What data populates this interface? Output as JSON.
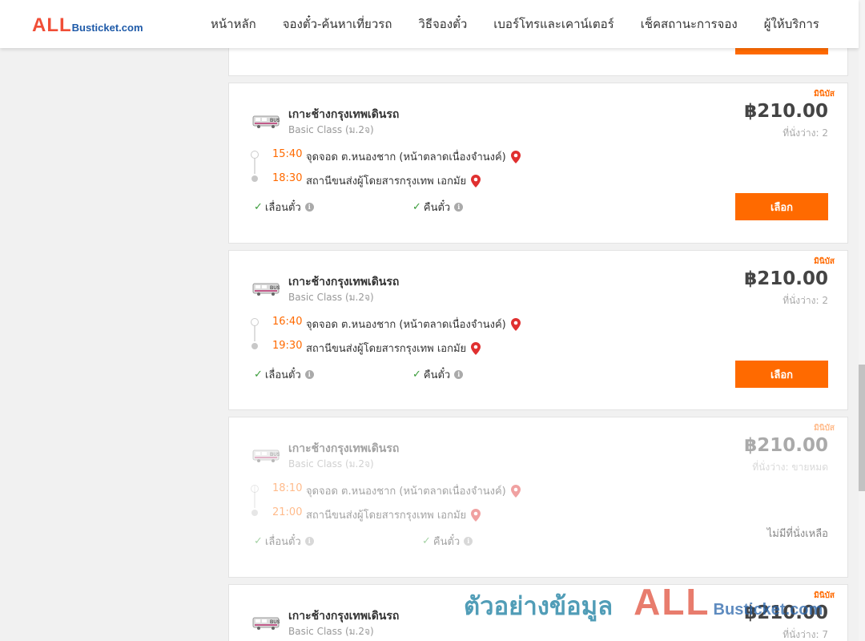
{
  "header": {
    "logo_all": "ALL",
    "logo_rest": "Busticket.com",
    "nav": [
      "หน้าหลัก",
      "จองตั๋ว-ค้นหาเที่ยวรถ",
      "วิธีจองตั๋ว",
      "เบอร์โทรและเคาน์เตอร์",
      "เช็คสถานะการจอง",
      "ผู้ให้บริการ"
    ]
  },
  "trips": [
    {
      "bus_type": "มินิบัส",
      "operator": "เกาะช้างกรุงเทพเดินรถ",
      "class": "Basic Class (ม.2จ)",
      "price": "฿210.00",
      "seats": "ที่นั่งว่าง: 2",
      "dep_time": "15:40",
      "dep_loc": "จุดจอด ต.หนองชาก (หน้าตลาดเนื่องจำนงค์)",
      "arr_time": "18:30",
      "arr_loc": "สถานีขนส่งผู้โดยสารกรุงเทพ เอกมัย",
      "feat_move": "เลื่อนตั๋ว",
      "feat_refund": "คืนตั๋ว",
      "button": "เลือก"
    },
    {
      "bus_type": "มินิบัส",
      "operator": "เกาะช้างกรุงเทพเดินรถ",
      "class": "Basic Class (ม.2จ)",
      "price": "฿210.00",
      "seats": "ที่นั่งว่าง: 2",
      "dep_time": "16:40",
      "dep_loc": "จุดจอด ต.หนองชาก (หน้าตลาดเนื่องจำนงค์)",
      "arr_time": "19:30",
      "arr_loc": "สถานีขนส่งผู้โดยสารกรุงเทพ เอกมัย",
      "feat_move": "เลื่อนตั๋ว",
      "feat_refund": "คืนตั๋ว",
      "button": "เลือก"
    },
    {
      "bus_type": "มินิบัส",
      "operator": "เกาะช้างกรุงเทพเดินรถ",
      "class": "Basic Class (ม.2จ)",
      "price": "฿210.00",
      "seats": "ที่นั่งว่าง: ขายหมด",
      "dep_time": "18:10",
      "dep_loc": "จุดจอด ต.หนองชาก (หน้าตลาดเนื่องจำนงค์)",
      "arr_time": "21:00",
      "arr_loc": "สถานีขนส่งผู้โดยสารกรุงเทพ เอกมัย",
      "feat_move": "เลื่อนตั๋ว",
      "feat_refund": "คืนตั๋ว",
      "status": "ไม่มีที่นั่งเหลือ"
    },
    {
      "bus_type": "มินิบัส",
      "operator": "เกาะช้างกรุงเทพเดินรถ",
      "class": "Basic Class (ม.2จ)",
      "price": "฿210.00",
      "seats": "ที่นั่งว่าง: 7"
    }
  ],
  "watermark": {
    "text": "ตัวอย่างข้อมูล",
    "all": "ALL",
    "rest": "Busticket.com"
  },
  "colors": {
    "accent": "#ff6a00",
    "logo_red": "#f04e37",
    "logo_blue": "#1e5aa8",
    "check_green": "#3a9c3a",
    "pin_red": "#e03030"
  }
}
